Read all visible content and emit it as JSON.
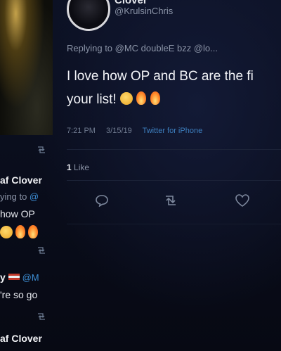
{
  "main_tweet": {
    "display_name": "Clover",
    "handle": "@KrulsinChris",
    "replying_to": "Replying to @MC doubleE bzz @lo...",
    "text_line1": "I love how OP and BC are the fi",
    "text_line2": "your list!",
    "time": "7:21 PM",
    "date": "3/15/19",
    "source": "Twitter for iPhone",
    "like_count": "1",
    "like_label": "Like"
  },
  "left_feed": {
    "name1": "af Clover",
    "replying1_prefix": "ying to ",
    "replying1_mention": "@",
    "text1": "how OP",
    "name2_prefix": "y",
    "mention2": "@M",
    "text2": "'re so go",
    "name3": "af Clover"
  },
  "icons": [
    "reply-icon",
    "retweet-icon",
    "like-icon",
    "smile-emoji",
    "fire-emoji"
  ]
}
